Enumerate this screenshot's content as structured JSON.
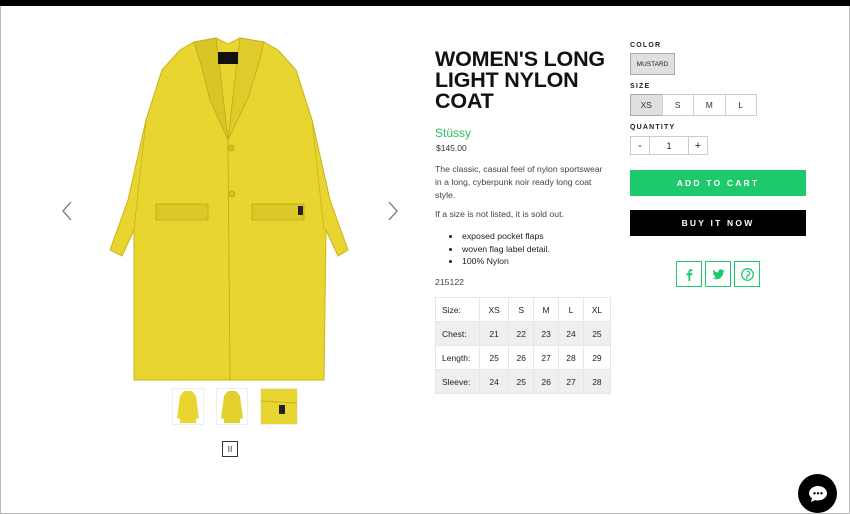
{
  "product": {
    "title": "WOMEN'S LONG LIGHT NYLON COAT",
    "brand": "Stüssy",
    "price": "$145.00",
    "description": "The classic, casual feel of nylon sportswear in a long, cyberpunk noir ready long coat style.",
    "sold_note": "If a size is not listed, it is sold out.",
    "features": [
      "exposed pocket flaps",
      "woven flag label detail.",
      "100% Nylon"
    ],
    "sku": "215122"
  },
  "size_chart": {
    "headers": [
      "Size:",
      "XS",
      "S",
      "M",
      "L",
      "XL"
    ],
    "rows": [
      [
        "Chest:",
        "21",
        "22",
        "23",
        "24",
        "25"
      ],
      [
        "Length:",
        "25",
        "26",
        "27",
        "28",
        "29"
      ],
      [
        "Sleeve:",
        "24",
        "25",
        "26",
        "27",
        "28"
      ]
    ]
  },
  "options": {
    "color_label": "COLOR",
    "color_value": "MUSTARD",
    "size_label": "SIZE",
    "sizes": [
      "XS",
      "S",
      "M",
      "L"
    ],
    "selected_size": "XS",
    "quantity_label": "QUANTITY",
    "quantity": "1",
    "minus": "-",
    "plus": "+"
  },
  "buttons": {
    "add_to_cart": "ADD TO CART",
    "buy_now": "BUY IT NOW"
  },
  "gallery": {
    "pause_glyph": "II",
    "thumbnail_count": 3
  },
  "colors": {
    "accent": "#1dc96b",
    "brand_text": "#2dbe60",
    "coat": "#e8d530",
    "black": "#000000"
  },
  "icons": {
    "share": [
      "facebook-icon",
      "twitter-icon",
      "pinterest-icon"
    ],
    "chat": "chat-icon"
  }
}
